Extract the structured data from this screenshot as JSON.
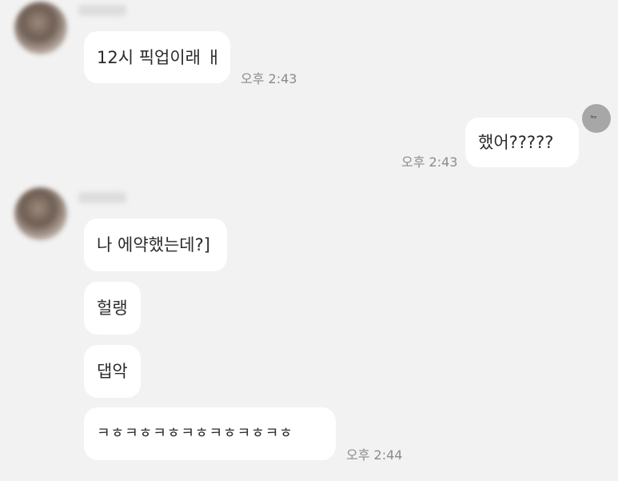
{
  "chat": {
    "messages": [
      {
        "text": "12시 픽업이래 ㅐ",
        "time": "오후 2:43"
      },
      {
        "text": "했어?????",
        "time": "오후 2:43"
      },
      {
        "text": "나 에약했는데?]"
      },
      {
        "text": "헐랭"
      },
      {
        "text": "댑악"
      },
      {
        "text": "ㅋㅎㅋㅎㅋㅎㅋㅎㅋㅎㅋㅎㅋㅎ",
        "time": "오후 2:44"
      }
    ]
  },
  "icons": {
    "my_avatar": "face-icon"
  },
  "colors": {
    "background": "#f2f2f2",
    "bubble": "#ffffff",
    "time_text": "#8b8b8b"
  }
}
